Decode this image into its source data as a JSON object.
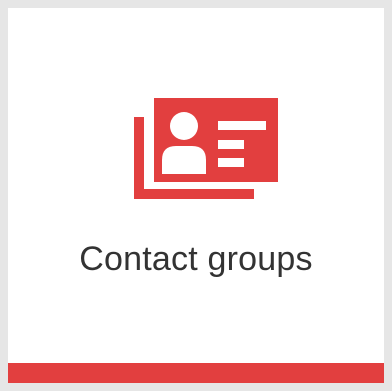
{
  "tile": {
    "label": "Contact groups",
    "icon": "contact-card-stack-icon"
  },
  "colors": {
    "background": "#e6e6e6",
    "tile": "#ffffff",
    "accent": "#e23f3f",
    "text": "#333333"
  }
}
